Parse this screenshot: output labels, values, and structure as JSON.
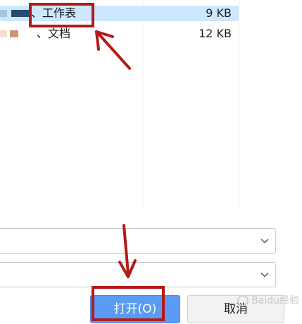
{
  "files": [
    {
      "name": "、工作表",
      "size": "9 KB",
      "selected": true
    },
    {
      "name": "、文档",
      "size": "12 KB",
      "selected": false
    }
  ],
  "dropdowns": [
    {
      "value": ""
    },
    {
      "value": ""
    }
  ],
  "buttons": {
    "open_label": "打开(O)",
    "cancel_label": "取消"
  },
  "watermark": "Baidu经验",
  "colors": {
    "selection": "#cce8ff",
    "primary_button": "#5b9bf5",
    "annotation": "#b31a1a"
  },
  "icons": {
    "dropdown": "chevron-down-icon"
  }
}
